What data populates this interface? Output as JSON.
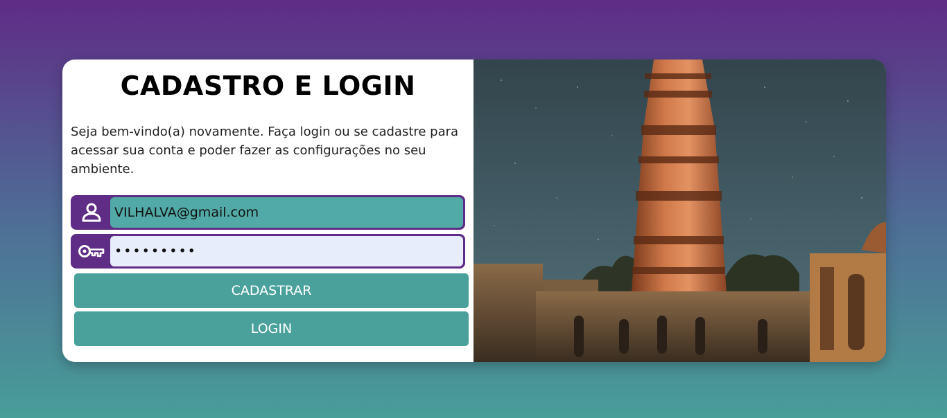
{
  "page": {
    "title": "CADASTRO E LOGIN",
    "description": "Seja bem-vindo(a) novamente. Faça login ou se cadastre para acessar sua conta e poder fazer as configurações no seu ambiente."
  },
  "form": {
    "email_value": "VILHALVA@gmail.com",
    "password_value": "•••••••••",
    "user_icon": "user-icon",
    "password_icon": "key-icon"
  },
  "buttons": {
    "register_label": "CADASTRAR",
    "login_label": "LOGIN"
  },
  "image": {
    "subject": "qutub-minar-night-photo"
  },
  "colors": {
    "accent_purple": "#5f2c86",
    "accent_teal": "#4aa19b",
    "email_field_bg": "#52aaa6",
    "password_field_bg": "#e8edfb"
  }
}
